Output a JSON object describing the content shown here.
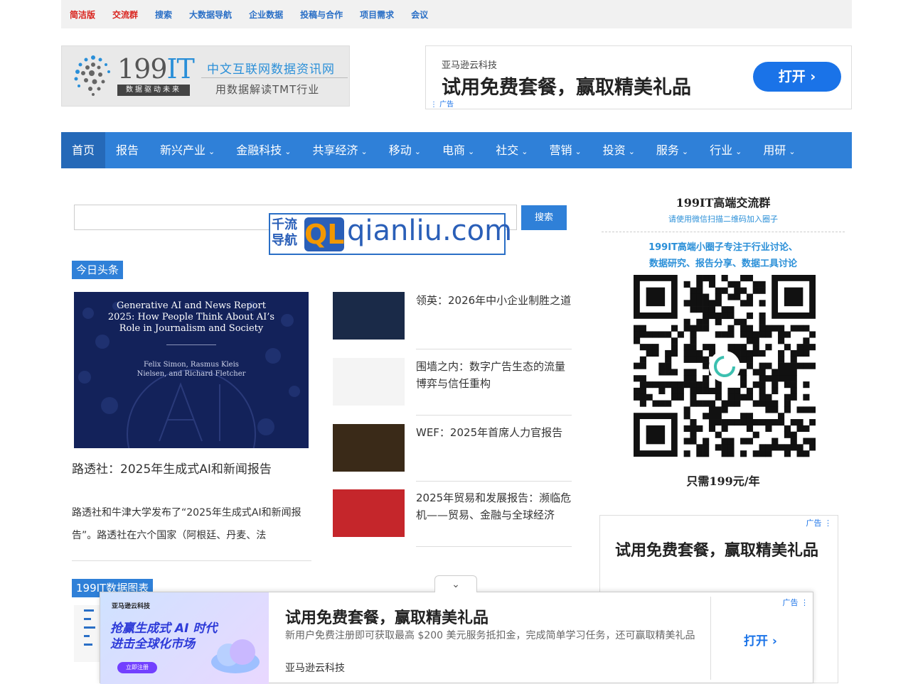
{
  "topbar": {
    "links": [
      {
        "label": "简洁版",
        "color": "#d9231d"
      },
      {
        "label": "交流群",
        "color": "#d9231d"
      },
      {
        "label": "搜索",
        "color": "#2a6fc6"
      },
      {
        "label": "大数据导航",
        "color": "#2a6fc6"
      },
      {
        "label": "企业数据",
        "color": "#2a6fc6"
      },
      {
        "label": "投稿与合作",
        "color": "#2a6fc6"
      },
      {
        "label": "项目需求",
        "color": "#2a6fc6"
      },
      {
        "label": "会议",
        "color": "#2a6fc6"
      }
    ]
  },
  "logo": {
    "number": "199",
    "suffix": "IT",
    "slogan_box": "数据驱动未来",
    "site_name": "中文互联网数据资讯网",
    "tagline": "用数据解读TMT行业"
  },
  "top_ad": {
    "advertiser": "亚马逊云科技",
    "headline": "试用免费套餐，赢取精美礼品",
    "button": "打开 ›",
    "tag": "⋮ 广告"
  },
  "nav": {
    "items": [
      {
        "label": "首页",
        "active": true,
        "dropdown": false
      },
      {
        "label": "报告",
        "active": false,
        "dropdown": false
      },
      {
        "label": "新兴产业",
        "active": false,
        "dropdown": true
      },
      {
        "label": "金融科技",
        "active": false,
        "dropdown": true
      },
      {
        "label": "共享经济",
        "active": false,
        "dropdown": true
      },
      {
        "label": "移动",
        "active": false,
        "dropdown": true
      },
      {
        "label": "电商",
        "active": false,
        "dropdown": true
      },
      {
        "label": "社交",
        "active": false,
        "dropdown": true
      },
      {
        "label": "营销",
        "active": false,
        "dropdown": true
      },
      {
        "label": "投资",
        "active": false,
        "dropdown": true
      },
      {
        "label": "服务",
        "active": false,
        "dropdown": true
      },
      {
        "label": "行业",
        "active": false,
        "dropdown": true
      },
      {
        "label": "用研",
        "active": false,
        "dropdown": true
      }
    ]
  },
  "search": {
    "value": "",
    "button": "搜索"
  },
  "qianliu": {
    "cn": "千流导航",
    "badge": "QL",
    "url": "qianliu.com"
  },
  "headlines": {
    "section_label": "今日头条",
    "feature": {
      "image_title": "Generative AI and News Report 2025: How People Think About AI’s Role in Journalism and Society",
      "image_authors": "Felix Simon, Rasmus Kleis Nielsen, and Richard Fletcher",
      "title": "路透社：2025年生成式AI和新闻报告",
      "desc": "路透社和牛津大学发布了“2025年生成式AI和新闻报告”。路透社在六个国家（阿根廷、丹麦、法"
    },
    "items": [
      {
        "title": "领英：2026年中小企业制胜之道",
        "thumb_color": "#1a2a48"
      },
      {
        "title": "围墙之内：数字广告生态的流量博弈与信任重构",
        "thumb_color": "#f4f4f4"
      },
      {
        "title": "WEF：2025年首席人力官报告",
        "thumb_color": "#3a2a18"
      },
      {
        "title": "2025年贸易和发展报告：濒临危机——贸易、金融与全球经济",
        "thumb_color": "#c5262b"
      }
    ]
  },
  "charts_section": {
    "label": "199IT数据图表"
  },
  "sidebar": {
    "title": "199IT高端交流群",
    "subtitle": "请使用微信扫描二维码加入圈子",
    "line1": "199IT高端小圈子专注于行业讨论、",
    "line2": "数据研究、报告分享、数据工具讨论",
    "price": "只需199元/年"
  },
  "side_ad": {
    "tag": "广告 ⋮",
    "headline": "试用免费套餐，赢取精美礼品"
  },
  "bottom_ad": {
    "image_brand": "亚马逊云科技",
    "image_line1": "抢赢生成式 AI 时代",
    "image_line2": "进击全球化市场",
    "image_button": "立即注册",
    "headline": "试用免费套餐，赢取精美礼品",
    "desc": "新用户免费注册即可获取最高 $200 美元服务抵扣金，完成简单学习任务，还可赢取精美礼品",
    "advertiser": "亚马逊云科技",
    "button": "打开 ›",
    "tag": "广告 ⋮"
  }
}
